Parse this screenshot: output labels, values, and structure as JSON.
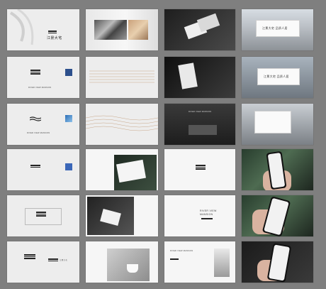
{
  "brand": {
    "tagline": "RIVER VIEW MANSION",
    "chinese_title": "江景大宅",
    "footnote": "RIVER VIEW MANSION"
  },
  "billboards": [
    "江景大宅 品质人居",
    "江景大宅 品质人居"
  ],
  "hero_lines": [
    "RIVER VIEW",
    "MANSION"
  ]
}
